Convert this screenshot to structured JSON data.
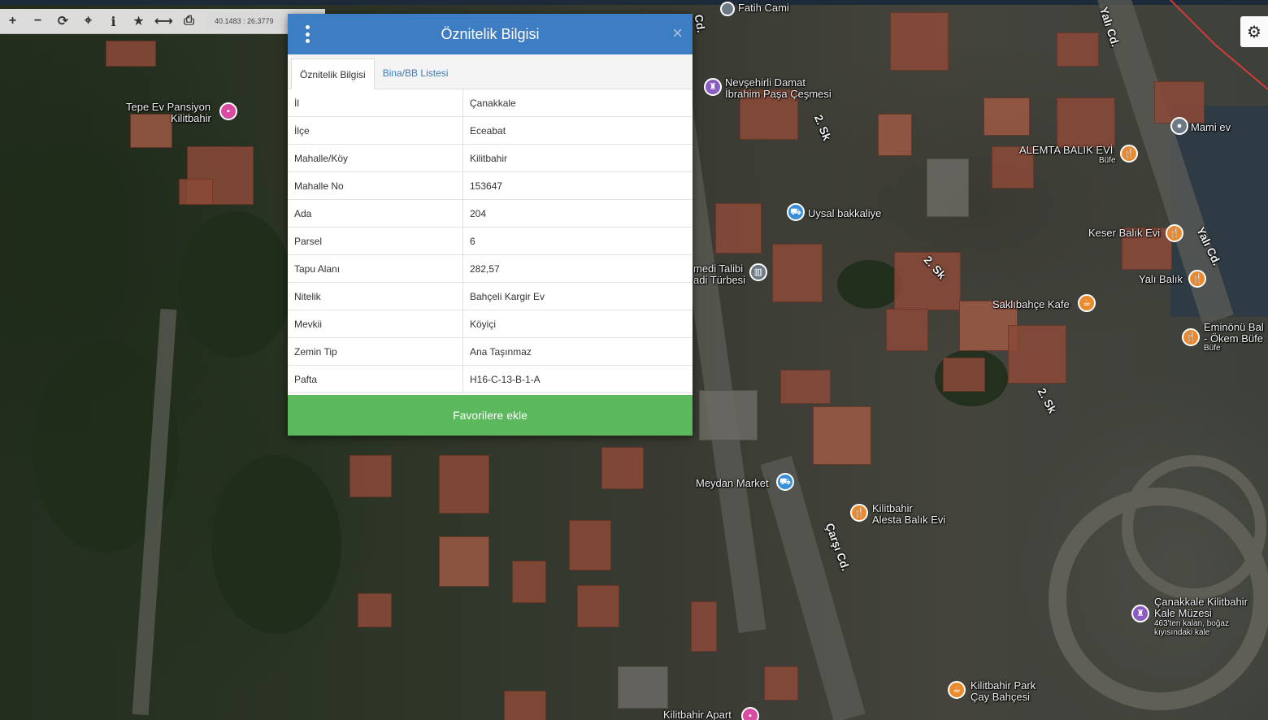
{
  "toolbar": {
    "zoom_in": "+",
    "zoom_out": "−",
    "refresh": "⟳",
    "locate": "⌖",
    "info": "i",
    "favorite": "★",
    "measure": "⟷",
    "print": "⎙",
    "coordinates": "40.1483 : 26.3779"
  },
  "settings_icon": "⚙",
  "dialog": {
    "title": "Öznitelik Bilgisi",
    "close": "×",
    "tabs": [
      {
        "label": "Öznitelik Bilgisi",
        "active": true
      },
      {
        "label": "Bina/BB Listesi",
        "active": false
      }
    ],
    "rows": [
      {
        "key": "İl",
        "value": "Çanakkale"
      },
      {
        "key": "İlçe",
        "value": "Eceabat"
      },
      {
        "key": "Mahalle/Köy",
        "value": "Kilitbahir"
      },
      {
        "key": "Mahalle No",
        "value": "153647"
      },
      {
        "key": "Ada",
        "value": "204"
      },
      {
        "key": "Parsel",
        "value": "6"
      },
      {
        "key": "Tapu Alanı",
        "value": "282,57"
      },
      {
        "key": "Nitelik",
        "value": "Bahçeli Kargir Ev"
      },
      {
        "key": "Mevkii",
        "value": "Köyiçi"
      },
      {
        "key": "Zemin Tip",
        "value": "Ana Taşınmaz"
      },
      {
        "key": "Pafta",
        "value": "H16-C-13-B-1-A"
      }
    ],
    "favorite_button": "Favorilere ekle"
  },
  "map_labels": {
    "tepe_ev": "Tepe Ev Pansiyon",
    "tepe_ev_sub": "Kilitbahir",
    "fatih_cami": "Fatih Cami",
    "nevsehirli": "Nevşehirli Damat",
    "nevsehirli_sub": "İbrahim Paşa Çeşmesi",
    "uysal": "Uysal bakkaliye",
    "mami": "Mami ev",
    "alemta": "ALEMTA BALIK EVİ",
    "alemta_sub": "Büfe",
    "keser": "Keser Balık Evi",
    "yali_balik": "Yalı Balık",
    "saklibahce": "Saklıbahçe Kafe",
    "eminonu": "Eminönü Bal",
    "eminonu_sub": "- Ökem Büfe",
    "eminonu_sub2": "Büfe",
    "talibi": "medi Talibi",
    "talibi_sub": "adi Türbesi",
    "meydan": "Meydan Market",
    "alesta": "Kilitbahir",
    "alesta_sub": "Alesta Balık Evi",
    "kale": "Çanakkale Kilitbahir",
    "kale_sub": "Kale Müzesi",
    "kale_desc": "463'ten kalan, boğaz",
    "kale_desc2": "kıyısındaki kale",
    "park": "Kilitbahir Park",
    "park_sub": "Çay Bahçesi",
    "apart": "Kilitbahir Apart",
    "yali_cd_1": "Yalı Cd.",
    "yali_cd_2": "Yalı Cd.",
    "sk_1": "2. Sk",
    "sk_2": "2. Sk",
    "sk_3": "2. Sk",
    "carsi": "Çarşı Cd.",
    "cd_top": "Cd."
  }
}
